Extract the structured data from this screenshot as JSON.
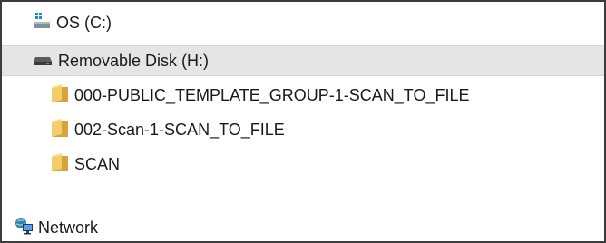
{
  "tree": {
    "items": [
      {
        "label": "OS (C:)",
        "icon": "drive-windows-icon"
      },
      {
        "label": "Removable Disk (H:)",
        "icon": "removable-disk-icon",
        "selected": true
      },
      {
        "label": "000-PUBLIC_TEMPLATE_GROUP-1-SCAN_TO_FILE",
        "icon": "folder-icon"
      },
      {
        "label": "002-Scan-1-SCAN_TO_FILE",
        "icon": "folder-icon"
      },
      {
        "label": "SCAN",
        "icon": "folder-icon"
      },
      {
        "label": "Network",
        "icon": "network-icon"
      }
    ]
  },
  "colors": {
    "selection_bg": "#e5e5e5",
    "folder_yellow": "#e8b84a",
    "windows_blue": "#1e88d8"
  }
}
